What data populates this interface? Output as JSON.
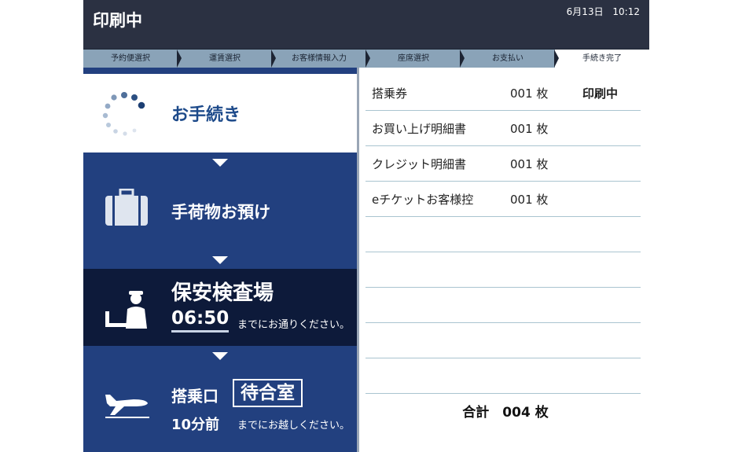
{
  "header": {
    "title": "印刷中",
    "date": "6月13日",
    "time": "10:12"
  },
  "steps": [
    "予約便選択",
    "運賃選択",
    "お客様情報入力",
    "座席選択",
    "お支払い",
    "手続き完了"
  ],
  "flow": {
    "procedure_label": "お手続き",
    "baggage_label": "手荷物お預け",
    "security_label": "保安検査場",
    "security_time": "06:50",
    "security_note": "までにお通りください。",
    "gate_label": "搭乗口",
    "gate_box": "待合室",
    "gate_minutes": "10分前",
    "gate_note": "までにお越しください。"
  },
  "print_items": [
    {
      "name": "搭乗券",
      "qty": "001 枚",
      "status": "印刷中"
    },
    {
      "name": "お買い上げ明細書",
      "qty": "001 枚",
      "status": ""
    },
    {
      "name": "クレジット明細書",
      "qty": "001 枚",
      "status": ""
    },
    {
      "name": "eチケットお客様控",
      "qty": "001 枚",
      "status": ""
    },
    {
      "name": "",
      "qty": "",
      "status": ""
    },
    {
      "name": "",
      "qty": "",
      "status": ""
    },
    {
      "name": "",
      "qty": "",
      "status": ""
    },
    {
      "name": "",
      "qty": "",
      "status": ""
    },
    {
      "name": "",
      "qty": "",
      "status": ""
    }
  ],
  "total": "合計　004 枚",
  "icons": {
    "loading": "loading-spinner-icon",
    "baggage": "suitcase-icon",
    "security": "security-officer-icon",
    "gate": "airplane-icon"
  }
}
